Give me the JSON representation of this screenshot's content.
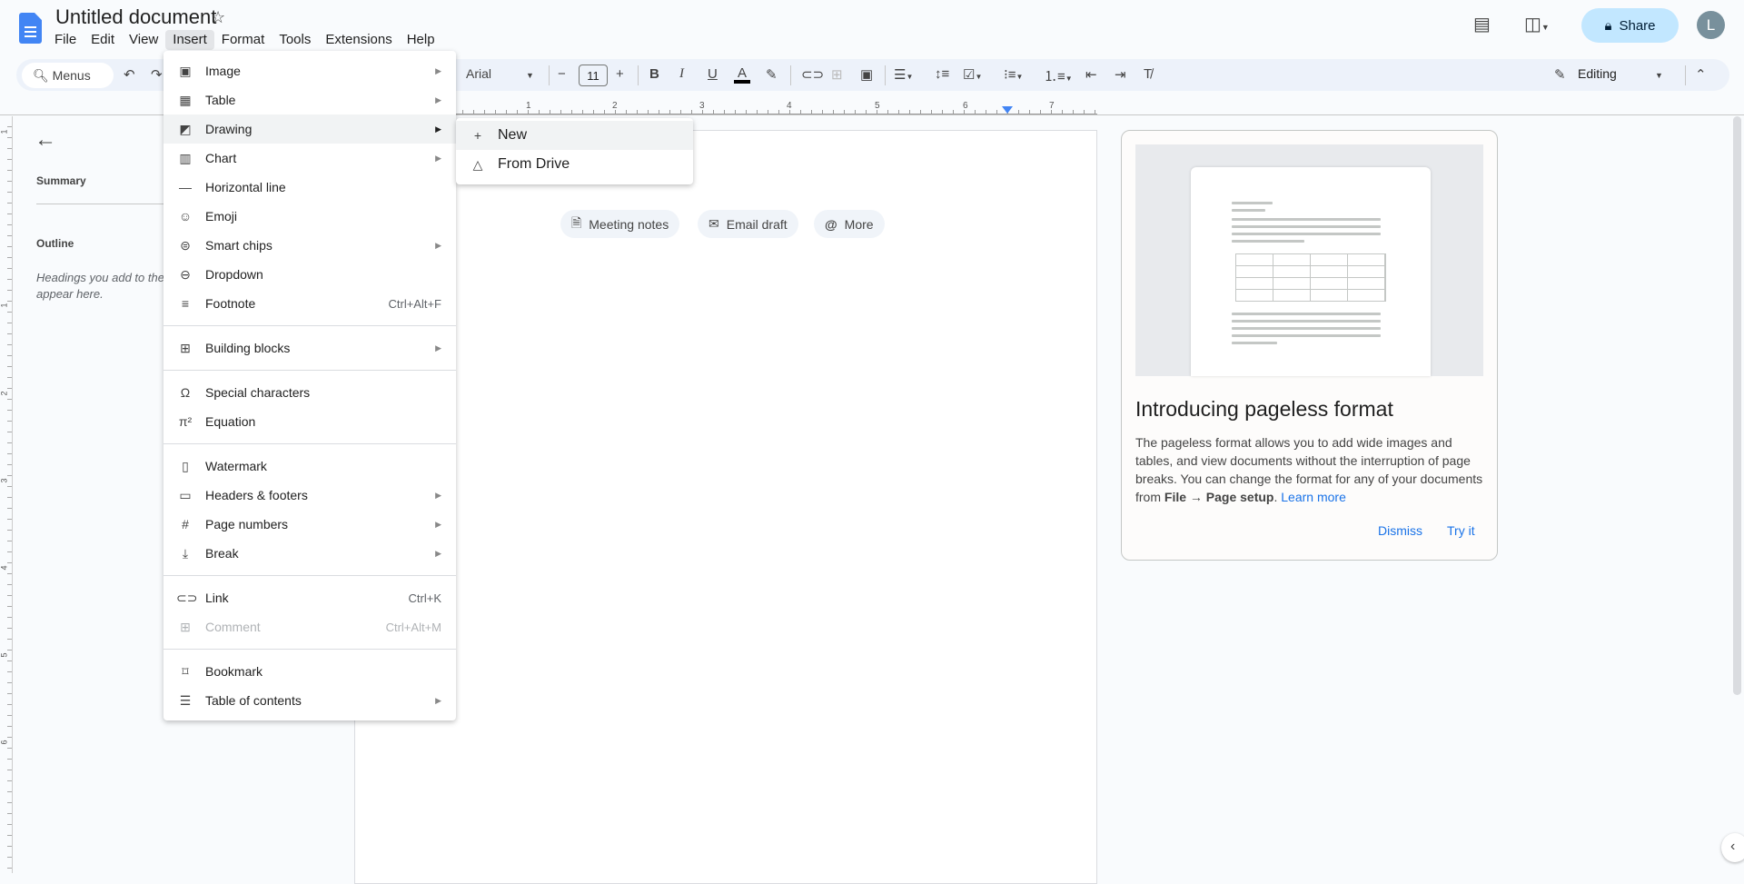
{
  "header": {
    "title": "Untitled document",
    "share_label": "Share",
    "avatar_initial": "L"
  },
  "menubar": [
    "File",
    "Edit",
    "View",
    "Insert",
    "Format",
    "Tools",
    "Extensions",
    "Help"
  ],
  "toolbar": {
    "search_label": "Menus",
    "font": "Arial",
    "font_size": "11",
    "mode": "Editing",
    "text_color": "#000000"
  },
  "ruler": {
    "h": [
      "1",
      "2",
      "3",
      "4",
      "5",
      "6",
      "7"
    ],
    "v": [
      "1",
      "1",
      "2",
      "3",
      "4",
      "5",
      "6"
    ]
  },
  "sidebar": {
    "summary": "Summary",
    "outline": "Outline",
    "hint": "Headings you add to the document will",
    "hint2": "appear here."
  },
  "chips": [
    "Meeting notes",
    "Email draft",
    "More"
  ],
  "insert_menu": [
    {
      "icon": "image-icon",
      "glyph": "▣",
      "label": "Image",
      "sub": true
    },
    {
      "icon": "table-icon",
      "glyph": "▦",
      "label": "Table",
      "sub": true
    },
    {
      "icon": "drawing-icon",
      "glyph": "◩",
      "label": "Drawing",
      "sub": true,
      "active": true
    },
    {
      "icon": "chart-icon",
      "glyph": "▥",
      "label": "Chart",
      "sub": true
    },
    {
      "icon": "horizontal-line-icon",
      "glyph": "—",
      "label": "Horizontal line"
    },
    {
      "icon": "emoji-icon",
      "glyph": "☺",
      "label": "Emoji"
    },
    {
      "icon": "smart-chips-icon",
      "glyph": "⊜",
      "label": "Smart chips",
      "sub": true
    },
    {
      "icon": "dropdown-icon",
      "glyph": "⊖",
      "label": "Dropdown"
    },
    {
      "icon": "footnote-icon",
      "glyph": "≡",
      "label": "Footnote",
      "shortcut": "Ctrl+Alt+F"
    },
    {
      "sep": true
    },
    {
      "icon": "building-blocks-icon",
      "glyph": "⊞",
      "label": "Building blocks",
      "sub": true
    },
    {
      "sep": true
    },
    {
      "icon": "omega-icon",
      "glyph": "Ω",
      "label": "Special characters"
    },
    {
      "icon": "pi-icon",
      "glyph": "π²",
      "label": "Equation"
    },
    {
      "sep": true
    },
    {
      "icon": "watermark-icon",
      "glyph": "▯",
      "label": "Watermark"
    },
    {
      "icon": "headers-footers-icon",
      "glyph": "▭",
      "label": "Headers & footers",
      "sub": true
    },
    {
      "icon": "hash-icon",
      "glyph": "#",
      "label": "Page numbers",
      "sub": true
    },
    {
      "icon": "break-icon",
      "glyph": "⤓",
      "label": "Break",
      "sub": true
    },
    {
      "sep": true
    },
    {
      "icon": "link-icon",
      "glyph": "⊂⊃",
      "label": "Link",
      "shortcut": "Ctrl+K"
    },
    {
      "icon": "add-comment-icon",
      "glyph": "⊞",
      "label": "Comment",
      "shortcut": "Ctrl+Alt+M",
      "disabled": true
    },
    {
      "sep": true
    },
    {
      "icon": "bookmark-icon",
      "glyph": "⌑",
      "label": "Bookmark"
    },
    {
      "icon": "table-of-contents-icon",
      "glyph": "☰",
      "label": "Table of contents",
      "sub": true
    }
  ],
  "drawing_submenu": [
    {
      "icon": "plus-icon",
      "glyph": "+",
      "label": "New",
      "active": true
    },
    {
      "icon": "drive-icon",
      "glyph": "△",
      "label": "From Drive"
    }
  ],
  "promo": {
    "title": "Introducing pageless format",
    "body1": "The pageless format allows you to add wide images and tables, and view documents without the interruption of page breaks. You can change the format for any of your documents from ",
    "bold1": "File → Page setup",
    "period": ".",
    "link": "Learn more",
    "dismiss": "Dismiss",
    "try": "Try it"
  }
}
